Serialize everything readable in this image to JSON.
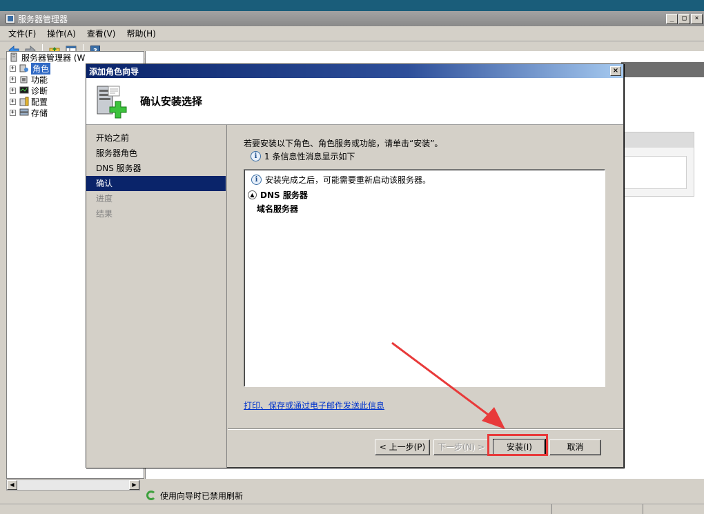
{
  "main_window": {
    "title": "服务器管理器",
    "controls": {
      "minimize": "_",
      "restore": "□",
      "close": "×"
    }
  },
  "menubar": {
    "items": [
      {
        "label": "文件(F)"
      },
      {
        "label": "操作(A)"
      },
      {
        "label": "查看(V)"
      },
      {
        "label": "帮助(H)"
      }
    ]
  },
  "toolbar": {
    "icons": [
      "back-icon",
      "forward-icon",
      "up-folder-icon",
      "show-hide-tree-icon",
      "help-icon"
    ]
  },
  "tree": {
    "root_label": "服务器管理器 (W",
    "items": [
      {
        "label": "角色",
        "icon": "roles-icon",
        "selected": true
      },
      {
        "label": "功能",
        "icon": "features-icon"
      },
      {
        "label": "诊断",
        "icon": "diagnostics-icon"
      },
      {
        "label": "配置",
        "icon": "configuration-icon"
      },
      {
        "label": "存储",
        "icon": "storage-icon"
      }
    ]
  },
  "status": {
    "refresh_text": "使用向导时已禁用刷新"
  },
  "dialog": {
    "title": "添加角色向导",
    "close": "×",
    "header_title": "确认安装选择",
    "nav": [
      {
        "label": "开始之前",
        "state": "normal"
      },
      {
        "label": "服务器角色",
        "state": "normal"
      },
      {
        "label": "DNS 服务器",
        "state": "normal"
      },
      {
        "label": "确认",
        "state": "active"
      },
      {
        "label": "进度",
        "state": "disabled"
      },
      {
        "label": "结果",
        "state": "disabled"
      }
    ],
    "instruction": "若要安装以下角色、角色服务或功能，请单击“安装”。",
    "info_count": "1 条信息性消息显示如下",
    "list": {
      "info_message": "安装完成之后，可能需要重新启动该服务器。",
      "section_title": "DNS 服务器",
      "item": "域名服务器"
    },
    "print_link": "打印、保存或通过电子邮件发送此信息",
    "buttons": {
      "prev": "< 上一步(P)",
      "next": "下一步(N) >",
      "install": "安装(I)",
      "cancel": "取消"
    }
  },
  "annotation": {
    "color": "#e83a3a"
  }
}
